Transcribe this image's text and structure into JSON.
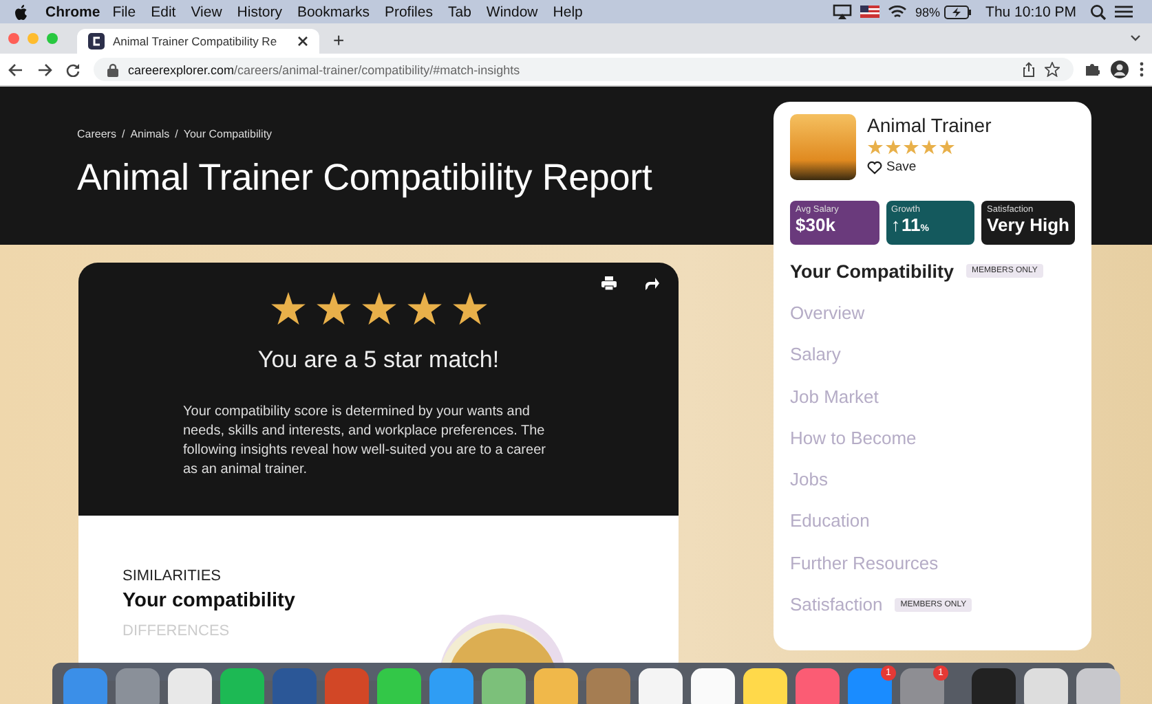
{
  "menu_bar": {
    "app": "Chrome",
    "items": [
      "File",
      "Edit",
      "View",
      "History",
      "Bookmarks",
      "Profiles",
      "Tab",
      "Window",
      "Help"
    ],
    "battery": "98%",
    "clock": "Thu 10:10 PM"
  },
  "tabs": [
    {
      "label": "Animal Trainer Compatibility Re",
      "selected": true
    }
  ],
  "new_tab": "+",
  "address_bar": {
    "host": "careerexplorer.com",
    "path": "/careers/animal-trainer/compatibility/#match-insights"
  },
  "header": {
    "breadcrumb": [
      "Careers",
      "Animals",
      "Your Compatibility"
    ],
    "separator": "/",
    "title": "Animal Trainer Compatibility Report"
  },
  "report_card": {
    "stars": 5,
    "heading": "You are a 5 star match!",
    "body": "Your compatibility score is determined by your wants and needs, skills and interests, and workplace preferences. The following insights reveal how well-suited you are to a career as an animal trainer.",
    "section_label": "SIMILARITIES",
    "section_title": "Your compatibility",
    "next_label": "DIFFERENCES"
  },
  "side_panel": {
    "title": "Animal Trainer",
    "stars": 5,
    "save": "Save",
    "stats": [
      {
        "label": "Avg Salary",
        "value": "$30k",
        "color": "#6a3a7c"
      },
      {
        "label": "Growth",
        "arrow": "↑",
        "value": "11",
        "unit": "%",
        "color": "#14595d"
      },
      {
        "label": "Satisfaction",
        "value": "Very High",
        "color": "#1b1b1b"
      }
    ],
    "nav": [
      {
        "label": "Your Compatibility",
        "selected": true,
        "badge": "MEMBERS ONLY"
      },
      {
        "label": "Overview",
        "selected": false
      },
      {
        "label": "Salary",
        "selected": false
      },
      {
        "label": "Job Market",
        "selected": false
      },
      {
        "label": "How to Become",
        "selected": false
      },
      {
        "label": "Jobs",
        "selected": false
      },
      {
        "label": "Education",
        "selected": false
      },
      {
        "label": "Further Resources",
        "selected": false
      },
      {
        "label": "Satisfaction",
        "selected": false,
        "badge": "MEMBERS ONLY"
      }
    ]
  },
  "dock": {
    "apps": [
      {
        "color": "#3b8fe8"
      },
      {
        "color": "#8a9099"
      },
      {
        "color": "#e8e8e8"
      },
      {
        "color": "#1db954"
      },
      {
        "color": "#2b5797"
      },
      {
        "color": "#d24726"
      },
      {
        "color": "#33c748"
      },
      {
        "color": "#2f9df4"
      },
      {
        "color": "#7cc07a"
      },
      {
        "color": "#f0b84a"
      },
      {
        "color": "#a57d52"
      },
      {
        "color": "#f4f4f4"
      },
      {
        "color": "#fafafa"
      },
      {
        "color": "#ffd94a"
      },
      {
        "color": "#fb5c74"
      },
      {
        "color": "#1a8cff",
        "badge": "1"
      },
      {
        "color": "#8e8e93",
        "badge": "1"
      }
    ],
    "others": [
      {
        "color": "#222222"
      },
      {
        "color": "#dddddd"
      },
      {
        "color": "#c8c8cc"
      }
    ]
  }
}
